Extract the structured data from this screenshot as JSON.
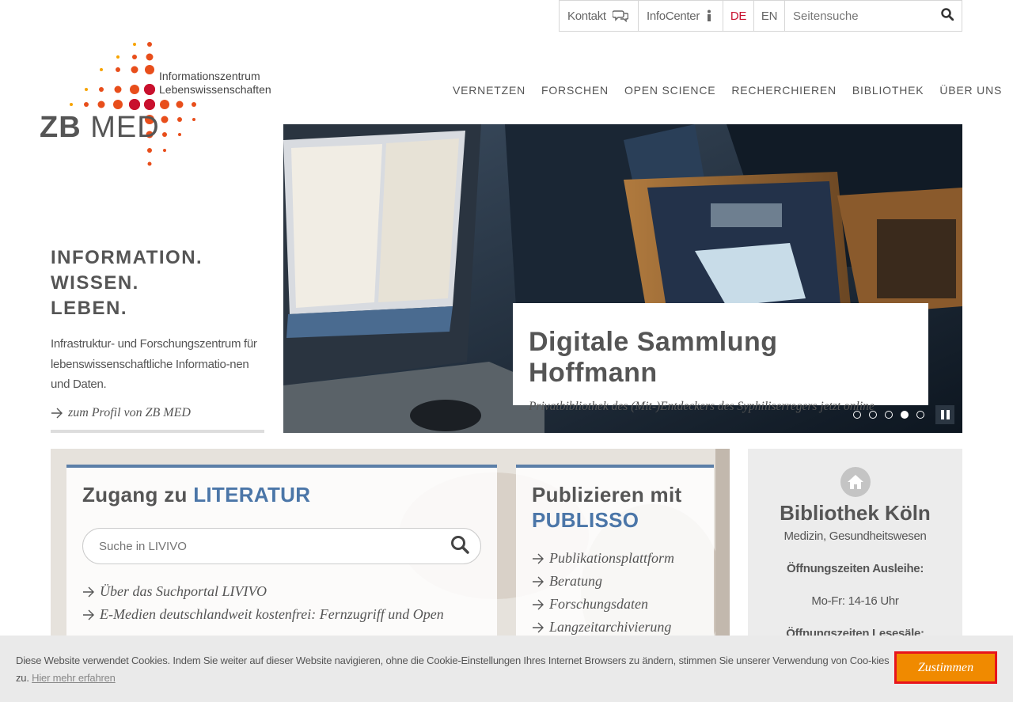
{
  "topbar": {
    "kontakt": "Kontakt",
    "infocenter": "InfoCenter",
    "lang_de": "DE",
    "lang_en": "EN",
    "search_placeholder": "Seitensuche"
  },
  "logo": {
    "zb": "ZB",
    "med": "MED",
    "tagline_1": "Informationszentrum",
    "tagline_2": "Lebenswissenschaften"
  },
  "nav": [
    "VERNETZEN",
    "FORSCHEN",
    "OPEN SCIENCE",
    "RECHERCHIEREN",
    "BIBLIOTHEK",
    "ÜBER UNS"
  ],
  "hero": {
    "slogan_1": "INFORMATION.",
    "slogan_2": "WISSEN.",
    "slogan_3": "LEBEN.",
    "description": "Infrastruktur- und Forschungszentrum für lebenswissenschaftliche Informatio-nen und Daten.",
    "profile_link": "zum Profil von ZB MED"
  },
  "slider": {
    "title": "Digitale Sammlung Hoffmann",
    "subtitle": "Privatbibliothek des (Mit-)Entdeckers des Syphiliserregers jetzt online",
    "slide_count": 5,
    "active_slide": 4
  },
  "literatur": {
    "heading_prefix": "Zugang zu",
    "heading_highlight": "LITERATUR",
    "search_placeholder": "Suche in LIVIVO",
    "links": [
      "Über das Suchportal LIVIVO",
      "E-Medien deutschlandweit kostenfrei: Fernzugriff und Open"
    ]
  },
  "publisso": {
    "heading_prefix": "Publizieren mit",
    "heading_highlight": "PUBLISSO",
    "links": [
      "Publikationsplattform",
      "Beratung",
      "Forschungsdaten",
      "Langzeitarchivierung"
    ]
  },
  "bibliothek": {
    "title": "Bibliothek Köln",
    "subtitle": "Medizin, Gesundheitswesen",
    "hours_label_1": "Öffnungszeiten Ausleihe:",
    "hours_value_1": "Mo-Fr: 14-16 Uhr",
    "hours_label_2": "Öffnungszeiten Lesesäle:"
  },
  "cookie": {
    "text": "Diese Website verwendet Cookies. Indem Sie weiter auf dieser Website navigieren, ohne die Cookie-Einstellungen Ihres Internet Browsers zu ändern, stimmen Sie unserer Verwendung von Coo-kies zu.",
    "link": "Hier mehr erfahren",
    "button": "Zustimmen"
  },
  "colors": {
    "accent_red": "#c8102e",
    "accent_blue": "#4b76a8",
    "cookie_button": "#f08a00"
  }
}
